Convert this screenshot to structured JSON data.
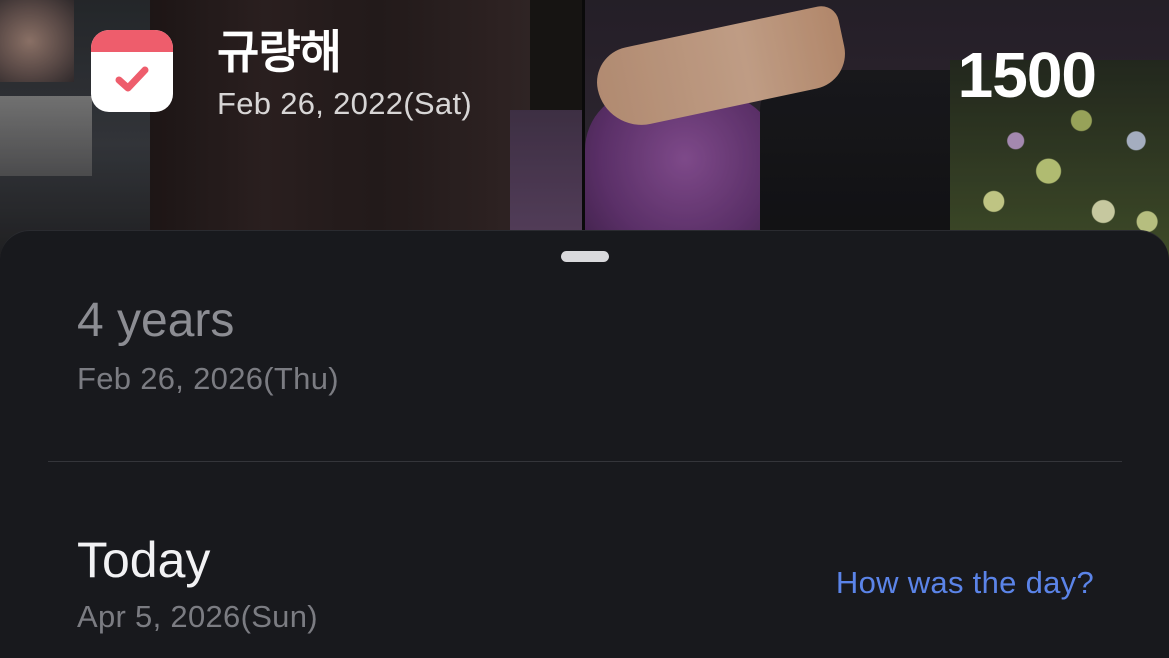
{
  "header": {
    "title": "규량해",
    "start_date": "Feb 26, 2022(Sat)",
    "count": "1500",
    "app_icon": "calendar-check-icon"
  },
  "milestone": {
    "label": "4 years",
    "date": "Feb 26, 2026(Thu)"
  },
  "today": {
    "label": "Today",
    "date": "Apr 5, 2026(Sun)",
    "link": "How was the day?"
  },
  "colors": {
    "sheet_background": "#18191d",
    "accent_link": "#5b84e8",
    "icon_band": "#ee5d6c"
  }
}
